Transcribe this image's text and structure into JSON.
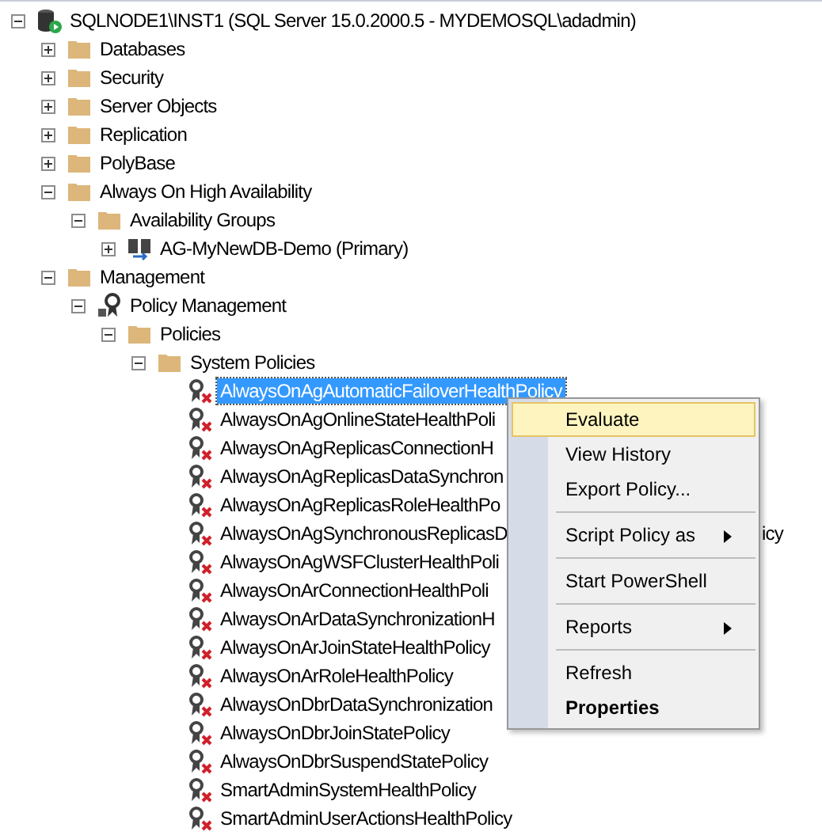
{
  "tree": [
    {
      "label": "SQLNODE1\\INST1 (SQL Server 15.0.2000.5 - MYDEMOSQL\\adadmin)",
      "kind": "server",
      "expanded": true,
      "selected": false,
      "children": [
        {
          "label": "Databases",
          "kind": "folder",
          "expanded": false,
          "selected": false
        },
        {
          "label": "Security",
          "kind": "folder",
          "expanded": false,
          "selected": false
        },
        {
          "label": "Server Objects",
          "kind": "folder",
          "expanded": false,
          "selected": false
        },
        {
          "label": "Replication",
          "kind": "folder",
          "expanded": false,
          "selected": false
        },
        {
          "label": "PolyBase",
          "kind": "folder",
          "expanded": false,
          "selected": false
        },
        {
          "label": "Always On High Availability",
          "kind": "folder",
          "expanded": true,
          "selected": false,
          "children": [
            {
              "label": "Availability Groups",
              "kind": "folder",
              "expanded": true,
              "selected": false,
              "children": [
                {
                  "label": "AG-MyNewDB-Demo (Primary)",
                  "kind": "ag",
                  "expanded": false,
                  "selected": false
                }
              ]
            }
          ]
        },
        {
          "label": "Management",
          "kind": "folder",
          "expanded": true,
          "selected": false,
          "children": [
            {
              "label": "Policy Management",
              "kind": "policy-mgmt",
              "expanded": true,
              "selected": false,
              "children": [
                {
                  "label": "Policies",
                  "kind": "folder",
                  "expanded": true,
                  "selected": false,
                  "children": [
                    {
                      "label": "System Policies",
                      "kind": "folder",
                      "expanded": true,
                      "selected": false,
                      "children": [
                        {
                          "label": "AlwaysOnAgAutomaticFailoverHealthPolicy",
                          "kind": "policy",
                          "selected": true
                        },
                        {
                          "label": "AlwaysOnAgOnlineStateHealthPoli",
                          "kind": "policy",
                          "selected": false
                        },
                        {
                          "label": "AlwaysOnAgReplicasConnectionH",
                          "kind": "policy",
                          "selected": false
                        },
                        {
                          "label": "AlwaysOnAgReplicasDataSynchron",
                          "kind": "policy",
                          "selected": false
                        },
                        {
                          "label": "AlwaysOnAgReplicasRoleHealthPo",
                          "kind": "policy",
                          "selected": false
                        },
                        {
                          "label": "AlwaysOnAgSynchronousReplicasD",
                          "tail": "icy",
                          "kind": "policy",
                          "selected": false
                        },
                        {
                          "label": "AlwaysOnAgWSFClusterHealthPoli",
                          "kind": "policy",
                          "selected": false
                        },
                        {
                          "label": "AlwaysOnArConnectionHealthPoli",
                          "kind": "policy",
                          "selected": false
                        },
                        {
                          "label": "AlwaysOnArDataSynchronizationH",
                          "kind": "policy",
                          "selected": false
                        },
                        {
                          "label": "AlwaysOnArJoinStateHealthPolicy",
                          "kind": "policy",
                          "selected": false
                        },
                        {
                          "label": "AlwaysOnArRoleHealthPolicy",
                          "kind": "policy",
                          "selected": false
                        },
                        {
                          "label": "AlwaysOnDbrDataSynchronization",
                          "kind": "policy",
                          "selected": false
                        },
                        {
                          "label": "AlwaysOnDbrJoinStatePolicy",
                          "kind": "policy",
                          "selected": false
                        },
                        {
                          "label": "AlwaysOnDbrSuspendStatePolicy",
                          "kind": "policy",
                          "selected": false
                        },
                        {
                          "label": "SmartAdminSystemHealthPolicy",
                          "kind": "policy",
                          "selected": false
                        },
                        {
                          "label": "SmartAdminUserActionsHealthPolicy",
                          "kind": "policy",
                          "selected": false
                        }
                      ]
                    }
                  ]
                }
              ]
            }
          ]
        }
      ]
    }
  ],
  "context_menu": [
    {
      "kind": "item",
      "label": "Evaluate",
      "selected": true,
      "submenu": false,
      "default": false
    },
    {
      "kind": "item",
      "label": "View History",
      "selected": false,
      "submenu": false,
      "default": false
    },
    {
      "kind": "item",
      "label": "Export Policy...",
      "selected": false,
      "submenu": false,
      "default": false
    },
    {
      "kind": "separator"
    },
    {
      "kind": "item",
      "label": "Script Policy as",
      "selected": false,
      "submenu": true,
      "default": false
    },
    {
      "kind": "separator"
    },
    {
      "kind": "item",
      "label": "Start PowerShell",
      "selected": false,
      "submenu": false,
      "default": false
    },
    {
      "kind": "separator"
    },
    {
      "kind": "item",
      "label": "Reports",
      "selected": false,
      "submenu": true,
      "default": false
    },
    {
      "kind": "separator"
    },
    {
      "kind": "item",
      "label": "Refresh",
      "selected": false,
      "submenu": false,
      "default": false
    },
    {
      "kind": "item",
      "label": "Properties",
      "selected": false,
      "submenu": false,
      "default": true
    }
  ]
}
